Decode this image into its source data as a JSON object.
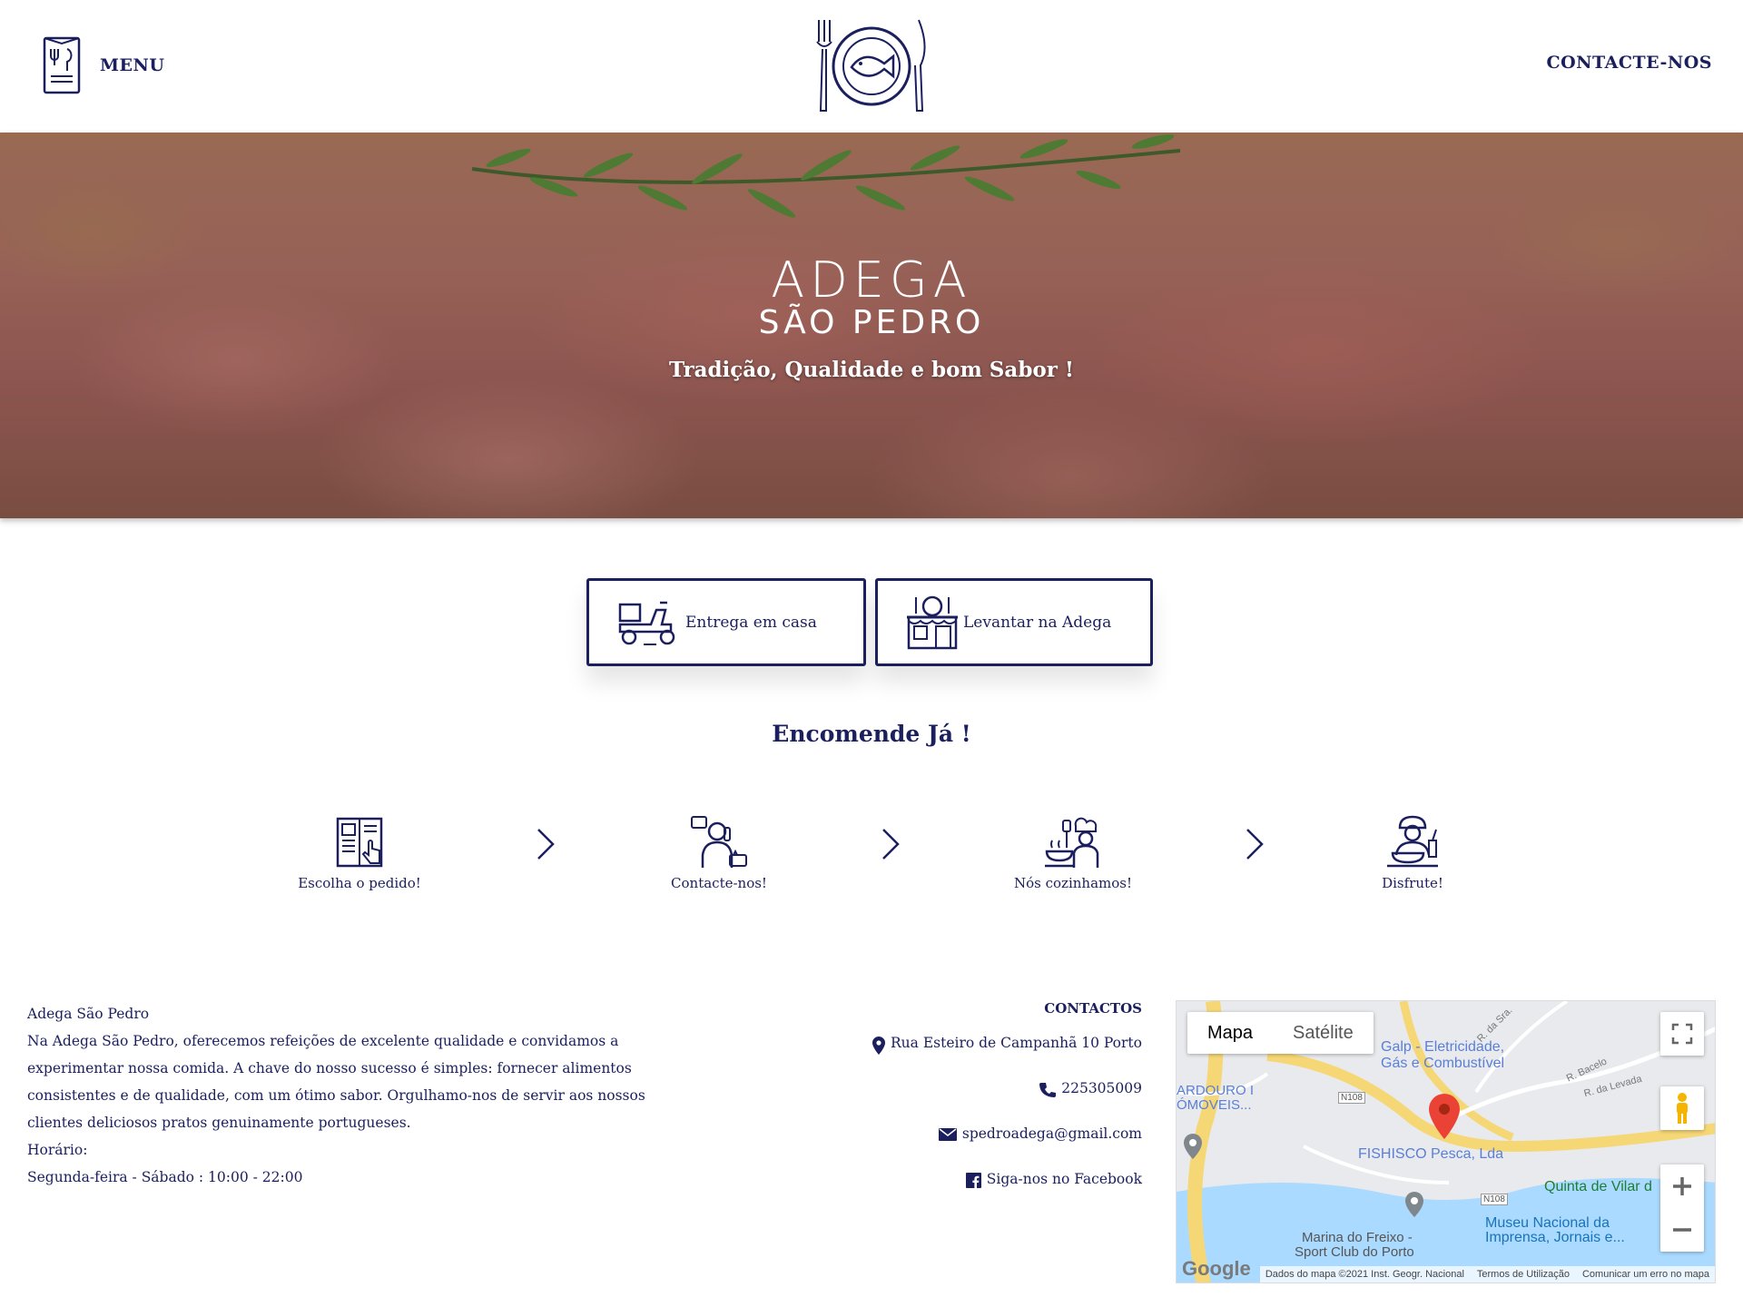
{
  "header": {
    "menu_label": "MENU",
    "contact_label": "CONTACTE-NOS",
    "menu_icon": "menu-book-icon",
    "logo_icon": "plate-fish-cutlery-logo"
  },
  "hero": {
    "brand_line1": "ADEGA",
    "brand_line2": "SÃO PEDRO",
    "tagline": "Tradição, Qualidade e bom Sabor !"
  },
  "order": {
    "delivery_label": "Entrega em casa",
    "pickup_label": "Levantar na Adega",
    "delivery_icon": "delivery-scooter-icon",
    "pickup_icon": "restaurant-store-icon",
    "title": "Encomende Já !"
  },
  "steps": [
    {
      "label": "Escolha o pedido!",
      "icon": "menu-select-icon"
    },
    {
      "label": "Contacte-nos!",
      "icon": "phone-contact-icon"
    },
    {
      "label": "Nós cozinhamos!",
      "icon": "chef-cooking-icon"
    },
    {
      "label": "Disfrute!",
      "icon": "eating-icon"
    }
  ],
  "about": {
    "name": "Adega São Pedro",
    "description": "Na Adega São Pedro, oferecemos refeições de excelente qualidade e convidamos a experimentar nossa comida. A chave do nosso sucesso é simples: fornecer alimentos consistentes e de qualidade, com um ótimo sabor. Orgulhamo-nos de servir aos nossos clientes deliciosos pratos genuinamente portugueses.",
    "hours_label": "Horário:",
    "hours_value": "Segunda-feira - Sábado : 10:00 - 22:00"
  },
  "contacts": {
    "title": "CONTACTOS",
    "address": "Rua Esteiro de Campanhã 10 Porto",
    "phone": "225305009",
    "email": "spedroadega@gmail.com",
    "facebook": "Siga-nos no Facebook"
  },
  "map": {
    "tab_map": "Mapa",
    "tab_satellite": "Satélite",
    "labels": {
      "galp": "Galp - Eletricidade,",
      "galp2": "Gás e Combustível",
      "moveis1": "ARDOURO I",
      "moveis2": "ÓMOVEIS...",
      "fishisco": "FISHISCO Pesca, Lda",
      "quinta": "Quinta de Vilar d",
      "museu1": "Museu Nacional da",
      "museu2": "Imprensa, Jornais e...",
      "marina1": "Marina do Freixo -",
      "marina2": "Sport Club do Porto",
      "n108a": "N108",
      "n108b": "N108",
      "r_barao": "R. da Sra.",
      "r_bacelo": "R. Bacelo",
      "r_levada": "R. da Levada"
    },
    "footer": {
      "data": "Dados do mapa ©2021 Inst. Geogr. Nacional",
      "terms": "Termos de Utilização",
      "report": "Comunicar um erro no mapa"
    },
    "google_logo": "Google",
    "colors": {
      "road": "#f6d776",
      "water": "#aadaff",
      "land": "#e8eaed",
      "pin": "#ea4335",
      "poi": "#5b7fd6"
    }
  },
  "colors": {
    "brand_navy": "#1b1f5e",
    "background": "#ffffff"
  }
}
